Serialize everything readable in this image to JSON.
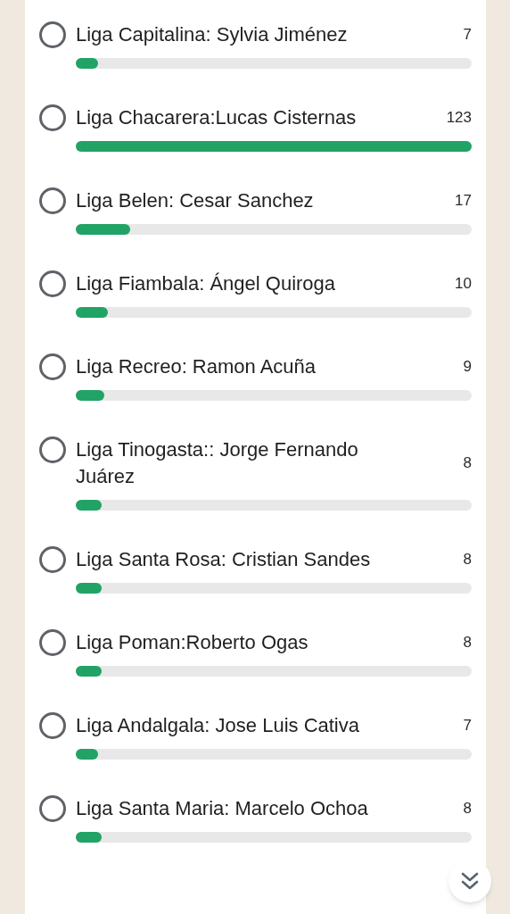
{
  "poll": {
    "options": [
      {
        "label": "Liga Capitalina: Sylvia Jiménez",
        "count": "7",
        "selected": false,
        "level": 0.057
      },
      {
        "label": "Liga Chacarera:Lucas Cisternas",
        "count": "123",
        "selected": false,
        "level": 1
      },
      {
        "label": "Liga Belen: Cesar Sanchez",
        "count": "17",
        "selected": false,
        "level": 0.138
      },
      {
        "label": "Liga Fiambala: Ángel Quiroga",
        "count": "10",
        "selected": false,
        "level": 0.081
      },
      {
        "label": "Liga Recreo: Ramon Acuña",
        "count": "9",
        "selected": false,
        "level": 0.073
      },
      {
        "label": "Liga Tinogasta:: Jorge Fernando Juárez",
        "count": "8",
        "selected": false,
        "level": 0.065
      },
      {
        "label": "Liga Santa Rosa: Cristian Sandes",
        "count": "8",
        "selected": false,
        "level": 0.065
      },
      {
        "label": "Liga Poman:Roberto Ogas",
        "count": "8",
        "selected": false,
        "level": 0.065
      },
      {
        "label": "Liga Andalgala: Jose Luis Cativa",
        "count": "7",
        "selected": false,
        "level": 0.057
      },
      {
        "label": "Liga Santa Maria: Marcelo Ochoa",
        "count": "8",
        "selected": false,
        "level": 0.065
      }
    ]
  }
}
